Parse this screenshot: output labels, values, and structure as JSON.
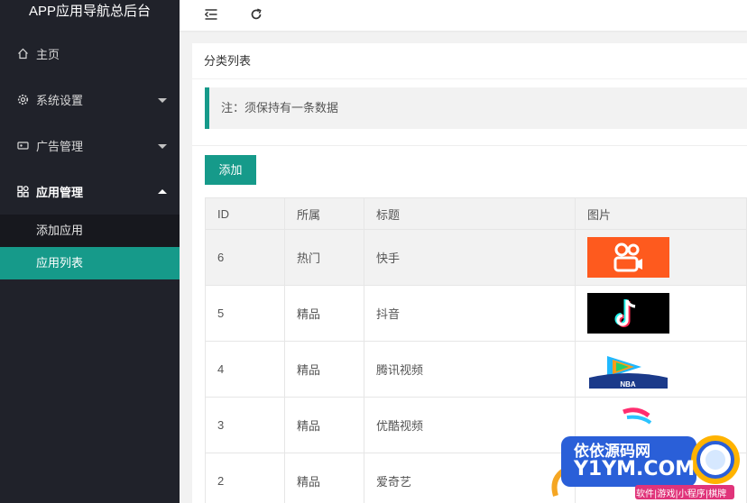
{
  "app": {
    "title": "APP应用导航总后台"
  },
  "sidebar": {
    "items": [
      {
        "label": "主页",
        "icon": "home-icon"
      },
      {
        "label": "系统设置",
        "icon": "gear-icon"
      },
      {
        "label": "广告管理",
        "icon": "ad-icon"
      },
      {
        "label": "应用管理",
        "icon": "apps-icon"
      }
    ],
    "subitems": [
      {
        "label": "添加应用"
      },
      {
        "label": "应用列表"
      }
    ]
  },
  "header": {
    "menu_icon": "menu-fold-icon",
    "refresh_icon": "refresh-icon"
  },
  "card": {
    "title": "分类列表",
    "notice": "注：须保持有一条数据",
    "add_label": "添加"
  },
  "table": {
    "columns": [
      "ID",
      "所属",
      "标题",
      "图片"
    ],
    "rows": [
      {
        "id": "6",
        "category": "热门",
        "title": "快手",
        "image": "kuaishou-logo"
      },
      {
        "id": "5",
        "category": "精品",
        "title": "抖音",
        "image": "douyin-logo"
      },
      {
        "id": "4",
        "category": "精品",
        "title": "腾讯视频",
        "image": "tencent-video-logo"
      },
      {
        "id": "3",
        "category": "精品",
        "title": "优酷视频",
        "image": "youku-logo"
      },
      {
        "id": "2",
        "category": "精品",
        "title": "爱奇艺",
        "image": "iqiyi-logo"
      }
    ]
  },
  "watermark": {
    "line1": "依依源码网",
    "line2": "Y1YM.COM",
    "line3": "软件|游戏|小程序|棋牌"
  },
  "colors": {
    "accent": "#169a8a",
    "sidebar": "#20222a",
    "kuaishou": "#fe5a1e"
  }
}
